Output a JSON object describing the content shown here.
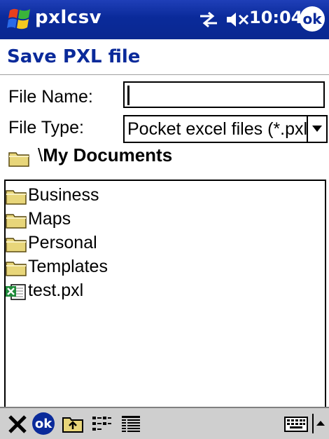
{
  "titlebar": {
    "app_name": "pxlcsv",
    "time": "10:04",
    "ok_label": "ok",
    "icons": [
      "windows-start-flag-icon",
      "connectivity-icon",
      "volume-muted-icon"
    ]
  },
  "dialog": {
    "title": "Save PXL file",
    "file_name_label": "File Name:",
    "file_name_value": "",
    "file_type_label": "File Type:",
    "file_type_selected": "Pocket excel files (*.pxl)",
    "path_prefix": "\\",
    "path_folder": "My Documents"
  },
  "files": [
    {
      "name": "Business",
      "type": "folder"
    },
    {
      "name": "Maps",
      "type": "folder"
    },
    {
      "name": "Personal",
      "type": "folder"
    },
    {
      "name": "Templates",
      "type": "folder"
    },
    {
      "name": "test.pxl",
      "type": "pxl-file"
    }
  ],
  "toolbar": {
    "ok_label": "ok",
    "icons": [
      "delete-x-icon",
      "ok-icon",
      "up-folder-icon",
      "list-view-icon",
      "details-view-icon",
      "keyboard-icon",
      "sip-arrow-icon"
    ]
  },
  "colors": {
    "titlebar": "#0a2a9a",
    "heading": "#0a2a9a",
    "folder": "#e8d67a",
    "toolbar": "#cfcfcf"
  }
}
